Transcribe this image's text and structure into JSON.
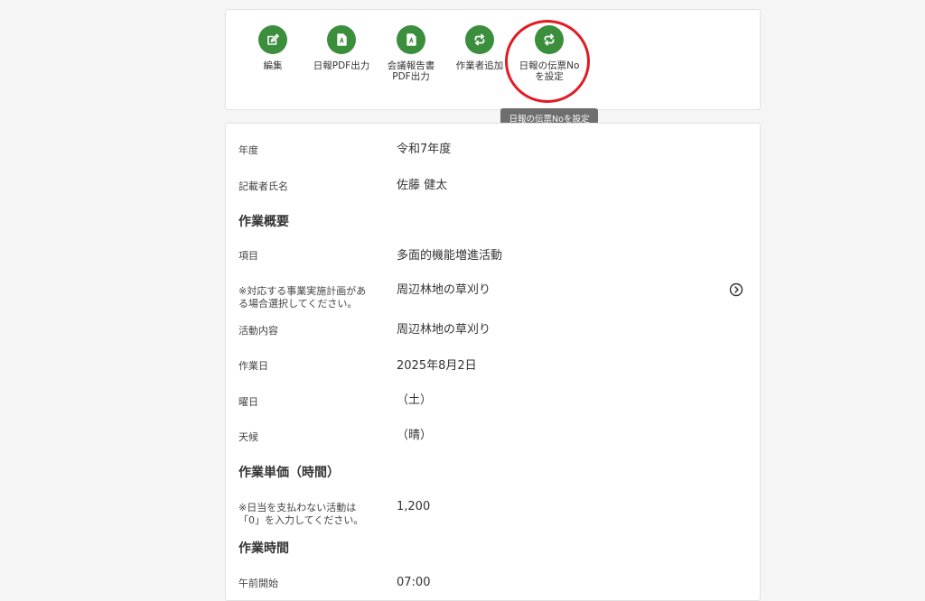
{
  "toolbar": {
    "buttons": [
      {
        "label": "編集",
        "icon": "edit-icon"
      },
      {
        "label": "日報PDF出力",
        "icon": "pdf-file-icon"
      },
      {
        "label": "会議報告書\nPDF出力",
        "icon": "pdf-file-icon"
      },
      {
        "label": "作業者追加",
        "icon": "swap-arrows-icon"
      },
      {
        "label": "日報の伝票No\nを設定",
        "icon": "swap-arrows-icon"
      }
    ],
    "tooltip": "日報の伝票Noを設定"
  },
  "colors": {
    "accent": "#3a8e3c",
    "highlight": "#e21b23",
    "tooltip_bg": "#6e6e6e"
  },
  "details": {
    "fiscal_year": {
      "label": "年度",
      "value": "令和7年度"
    },
    "author": {
      "label": "記載者氏名",
      "value": "佐藤 健太"
    },
    "section_overview": "作業概要",
    "item": {
      "label": "項目",
      "value": "多面的機能増進活動"
    },
    "plan": {
      "label": "※対応する事業実施計画があ\nる場合選択してください。",
      "value": "周辺林地の草刈り"
    },
    "activity": {
      "label": "活動内容",
      "value": "周辺林地の草刈り"
    },
    "work_date": {
      "label": "作業日",
      "value": "2025年8月2日"
    },
    "weekday": {
      "label": "曜日",
      "value": "（土）"
    },
    "weather": {
      "label": "天候",
      "value": "（晴）"
    },
    "section_unit_price": "作業単価（時間）",
    "unit_price": {
      "label": "※日当を支払わない活動は\n「0」を入力してください。",
      "value": "1,200"
    },
    "section_work_time": "作業時間",
    "am_start": {
      "label": "午前開始",
      "value": "07:00"
    }
  }
}
